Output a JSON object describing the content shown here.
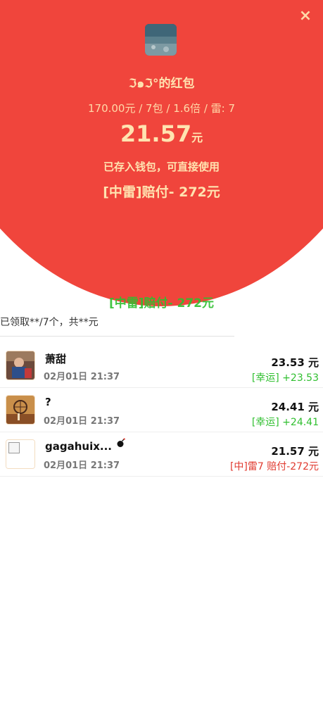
{
  "header": {
    "close_icon": "×",
    "sender_name": "ℑ๑ℑ°的红包",
    "packet_info": "170.00元 / 7包 / 1.6倍 / 雷: 7",
    "amount_value": "21.57",
    "amount_unit": "元",
    "wallet_note": "已存入钱包，可直接使用",
    "thunder_note": "[中雷]赔付- 272元",
    "thunder_echo": "[中雷]赔付- 272元",
    "bg_color": "#f0453c",
    "text_color": "#ffe3b0"
  },
  "summary": "已领取**/7个，共**元",
  "recipients": [
    {
      "name": "萧甜",
      "time": "02月01日  21:37",
      "amount": "23.53 元",
      "tag": "[幸运]  +23.53",
      "tag_type": "lucky",
      "avatar": "photo-avatar"
    },
    {
      "name": "?",
      "time": "02月01日  21:37",
      "amount": "24.41 元",
      "tag": "[幸运]  +24.41",
      "tag_type": "lucky",
      "avatar": "photo-avatar"
    },
    {
      "name": "gagahuix...",
      "time": "02月01日  21:37",
      "amount": "21.57 元",
      "tag": "[中]雷7 赔付-272元",
      "tag_type": "hit",
      "avatar": "broken-image",
      "badge_icon": "bomb-icon"
    }
  ],
  "colors": {
    "lucky": "#2fbf2f",
    "hit": "#e03a2f"
  }
}
